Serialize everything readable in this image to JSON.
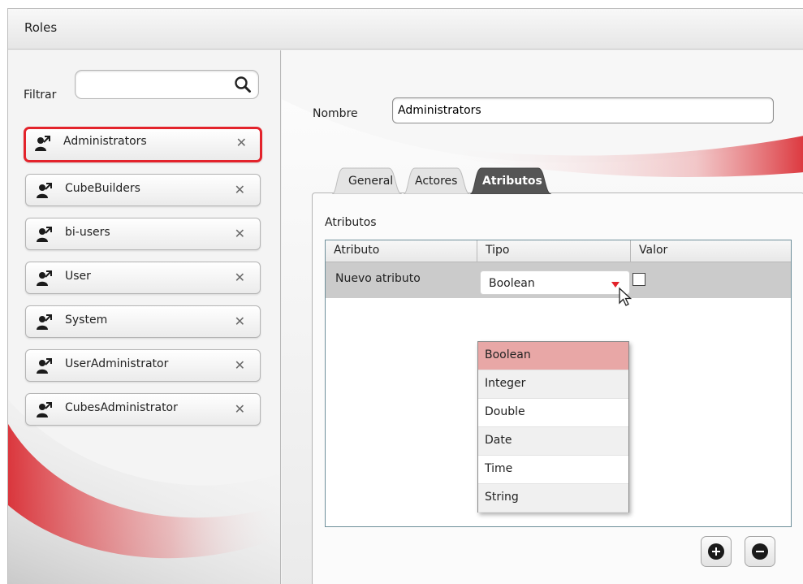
{
  "window": {
    "title": "Roles"
  },
  "filter": {
    "label": "Filtrar",
    "value": ""
  },
  "roles": [
    {
      "name": "Administrators",
      "selected": true
    },
    {
      "name": "CubeBuilders"
    },
    {
      "name": "bi-users"
    },
    {
      "name": "User"
    },
    {
      "name": "System"
    },
    {
      "name": "UserAdministrator"
    },
    {
      "name": "CubesAdministrator"
    }
  ],
  "remove_glyph": "✕",
  "nombre": {
    "label": "Nombre",
    "value": "Administrators"
  },
  "tabs": [
    {
      "label": "General"
    },
    {
      "label": "Actores"
    },
    {
      "label": "Atributos",
      "active": true
    }
  ],
  "atributos": {
    "section_label": "Atributos",
    "columns": [
      "Atributo",
      "Tipo",
      "Valor"
    ],
    "rows": [
      {
        "name": "Nuevo atributo",
        "type": "Boolean",
        "value": false
      }
    ],
    "type_options": [
      "Boolean",
      "Integer",
      "Double",
      "Date",
      "Time",
      "String"
    ],
    "selected_option": "Boolean"
  },
  "colors": {
    "accent": "#e3232b",
    "selected_option_bg": "#e8a7a6",
    "active_tab": "#555555",
    "row_bg": "#cbcbcb"
  },
  "icons": {
    "search": "search-icon",
    "role": "user-role-icon",
    "remove": "close-icon",
    "add": "add-icon",
    "remove_row": "remove-icon"
  }
}
